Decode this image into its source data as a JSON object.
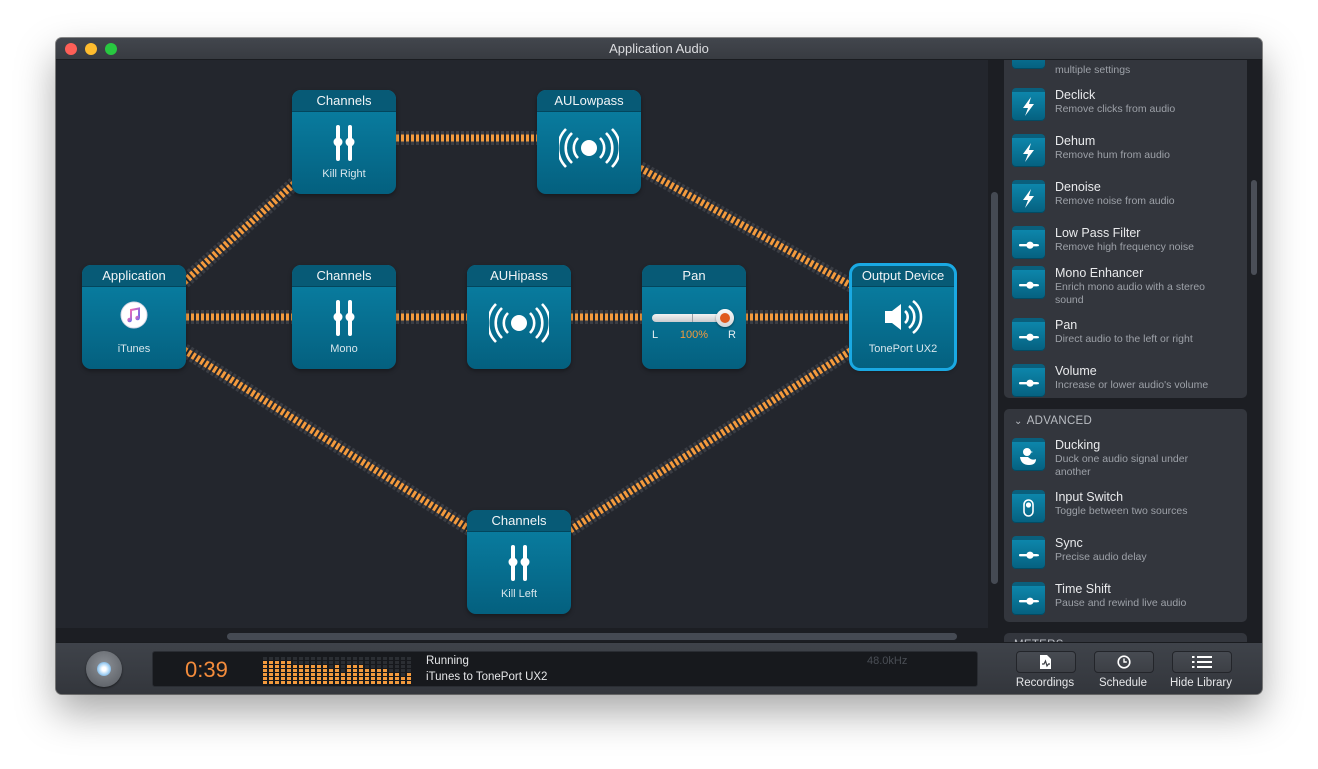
{
  "window": {
    "title": "Application Audio"
  },
  "nodes": {
    "application": {
      "title": "Application",
      "sub": "iTunes"
    },
    "channels_kill_right": {
      "title": "Channels",
      "sub": "Kill Right"
    },
    "channels_mono": {
      "title": "Channels",
      "sub": "Mono"
    },
    "channels_kill_left": {
      "title": "Channels",
      "sub": "Kill Left"
    },
    "aulowpass": {
      "title": "AULowpass"
    },
    "auhipass": {
      "title": "AUHipass"
    },
    "pan": {
      "title": "Pan",
      "left_label": "L",
      "right_label": "R",
      "value_label": "100%",
      "value_fraction": 1.0
    },
    "output": {
      "title": "Output Device",
      "sub": "TonePort UX2"
    }
  },
  "library": {
    "top_partial_desc": "multiple settings",
    "effects": [
      {
        "title": "Declick",
        "desc": "Remove clicks from audio",
        "icon": "lightning-icon"
      },
      {
        "title": "Dehum",
        "desc": "Remove hum from audio",
        "icon": "lightning-icon"
      },
      {
        "title": "Denoise",
        "desc": "Remove noise from audio",
        "icon": "lightning-icon"
      },
      {
        "title": "Low Pass Filter",
        "desc": "Remove high frequency noise",
        "icon": "slider-icon"
      },
      {
        "title": "Mono Enhancer",
        "desc": "Enrich mono audio with a stereo sound",
        "icon": "slider-icon"
      },
      {
        "title": "Pan",
        "desc": "Direct audio to the left or right",
        "icon": "slider-icon"
      },
      {
        "title": "Volume",
        "desc": "Increase or lower audio's volume",
        "icon": "slider-icon"
      }
    ],
    "advanced": {
      "header": "ADVANCED",
      "items": [
        {
          "title": "Ducking",
          "desc": "Duck one audio signal under another",
          "icon": "duck-icon"
        },
        {
          "title": "Input Switch",
          "desc": "Toggle between two sources",
          "icon": "switch-icon"
        },
        {
          "title": "Sync",
          "desc": "Precise audio delay",
          "icon": "slider-icon"
        },
        {
          "title": "Time Shift",
          "desc": "Pause and rewind live audio",
          "icon": "slider-icon"
        }
      ]
    },
    "next_section_header": "METERS"
  },
  "bottom": {
    "time": "0:39",
    "status": "Running",
    "route": "iTunes to TonePort UX2",
    "sample_rate": "48.0kHz",
    "meter_levels": [
      6,
      6,
      6,
      6,
      6,
      5,
      5,
      5,
      5,
      5,
      5,
      4,
      5,
      3,
      5,
      5,
      5,
      4,
      4,
      4,
      4,
      3,
      3,
      2,
      3
    ],
    "meter_max": 7,
    "buttons": {
      "recordings": "Recordings",
      "schedule": "Schedule",
      "hide_library": "Hide Library"
    }
  },
  "colors": {
    "accent_orange": "#f39a3d",
    "node_blue": "#0a7a9e",
    "selected_outline": "#1aa9e3"
  }
}
